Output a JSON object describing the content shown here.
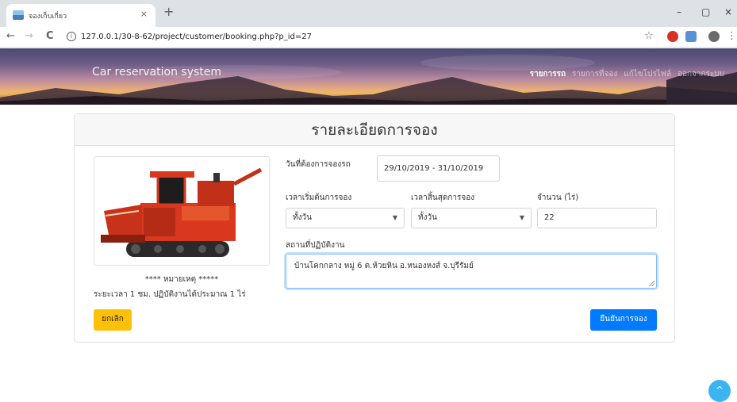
{
  "browser": {
    "tab_title": "จองเก็บเกี่ยว",
    "tab_close": "×",
    "new_tab": "+",
    "minimize": "–",
    "restore": "▢",
    "close": "×",
    "back": "←",
    "forward": "→",
    "reload": "C",
    "info": "i",
    "url": "127.0.0.1/30-8-62/project/customer/booking.php?p_id=27",
    "star": "☆",
    "menu": "⋮"
  },
  "site": {
    "brand": "Car reservation system",
    "nav": [
      "รายการรถ",
      "รายการที่จอง",
      "แก้ไขโปรไฟล์",
      "ออกจากระบบ"
    ],
    "active_nav_index": 0
  },
  "booking": {
    "title": "รายละเอียดการจอง",
    "image_alt": "Combine harvester",
    "note_heading": "**** หมายเหตุ *****",
    "note_text": "ระยะเวลา 1 ชม. ปฏิบัติงานได้ประมาณ 1 ไร่",
    "date_label": "วันที่ต้องการจองรถ",
    "date_value": "29/10/2019 - 31/10/2019",
    "start_label": "เวลาเริ่มต้นการจอง",
    "start_value": "ทั้งวัน",
    "end_label": "เวลาสิ้นสุดการจอง",
    "end_value": "ทั้งวัน",
    "amount_label": "จำนวน (ไร่)",
    "amount_value": "22",
    "location_label": "สถานที่ปฏิบัติงาน",
    "location_value": "บ้านโคกกลาง หมู่ 6 ต.ห้วยหิน อ.หนองหงส์ จ.บุรีรัมย์",
    "cancel_label": "ยกเลิก",
    "confirm_label": "ยืนยันการจอง"
  },
  "scroll_top": "^",
  "colors": {
    "confirm": "#007bff",
    "cancel": "#ffc107",
    "scroll_top": "#3bb4f2"
  }
}
